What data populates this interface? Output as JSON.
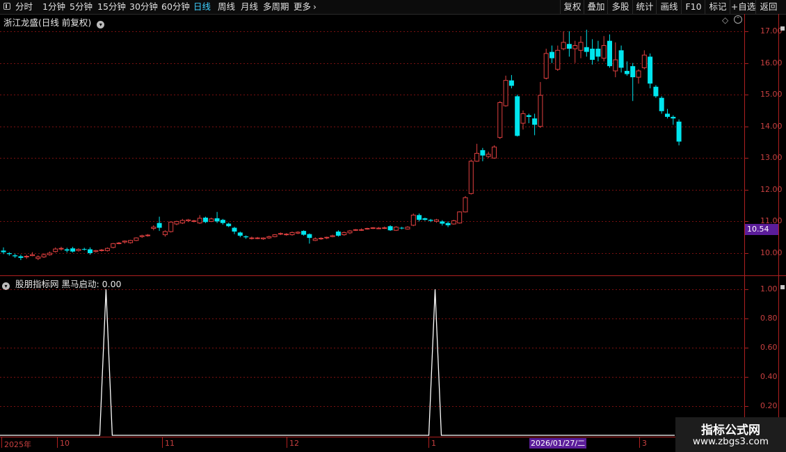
{
  "toolbar": {
    "periods": [
      "分时",
      "1分钟",
      "5分钟",
      "15分钟",
      "30分钟",
      "60分钟",
      "日线",
      "周线",
      "月线",
      "多周期",
      "更多"
    ],
    "active_period": "日线",
    "buttons": [
      "复权",
      "叠加",
      "多股",
      "统计",
      "画线",
      "F10",
      "标记",
      "+自选",
      "返回"
    ]
  },
  "main_panel": {
    "title": "浙江龙盛(日线 前复权)",
    "y_ticks": [
      "17.00",
      "16.00",
      "15.00",
      "14.00",
      "13.00",
      "12.00",
      "11.00",
      "10.00"
    ],
    "current_price": "10.54"
  },
  "indicator_panel": {
    "title": "股朋指标网 黑马启动: 0.00",
    "y_ticks": [
      "1.00",
      "0.80",
      "0.60",
      "0.40",
      "0.20"
    ]
  },
  "x_axis": {
    "labels": [
      "2025年",
      "10",
      "11",
      "12",
      "1",
      "3"
    ],
    "cursor_date": "2026/01/27/二"
  },
  "watermark": {
    "line1": "指标公式网",
    "line2": "www.zbgs3.com"
  },
  "colors": {
    "up": "#e04040",
    "down": "#00e5ee",
    "cursor": "#5b1d9a",
    "signal": "#ffffff"
  },
  "chart_data": [
    {
      "type": "candlestick",
      "ylim": [
        9.7,
        17.2
      ],
      "candles": [
        [
          10.08,
          10.03,
          10.18,
          9.97
        ],
        [
          10.0,
          9.97,
          10.03,
          9.92
        ],
        [
          9.93,
          9.9,
          9.98,
          9.85
        ],
        [
          9.9,
          9.85,
          9.95,
          9.78
        ],
        [
          9.88,
          9.9,
          9.95,
          9.82
        ],
        [
          9.92,
          9.95,
          10.03,
          9.9
        ],
        [
          9.83,
          9.88,
          9.93,
          9.78
        ],
        [
          9.88,
          9.95,
          10.0,
          9.85
        ],
        [
          9.95,
          10.0,
          10.05,
          9.92
        ],
        [
          10.05,
          10.13,
          10.18,
          10.02
        ],
        [
          10.13,
          10.15,
          10.2,
          10.08
        ],
        [
          10.12,
          10.08,
          10.17,
          10.02
        ],
        [
          10.15,
          10.05,
          10.2,
          10.02
        ],
        [
          10.08,
          10.12,
          10.15,
          10.05
        ],
        [
          10.13,
          10.12,
          10.17,
          10.08
        ],
        [
          10.12,
          10.0,
          10.18,
          9.95
        ],
        [
          10.05,
          10.08,
          10.1,
          10.02
        ],
        [
          10.08,
          10.1,
          10.13,
          10.05
        ],
        [
          10.08,
          10.15,
          10.18,
          10.05
        ],
        [
          10.18,
          10.3,
          10.32,
          10.15
        ],
        [
          10.3,
          10.32,
          10.35,
          10.28
        ],
        [
          10.35,
          10.38,
          10.4,
          10.3
        ],
        [
          10.33,
          10.4,
          10.42,
          10.3
        ],
        [
          10.4,
          10.48,
          10.5,
          10.38
        ],
        [
          10.52,
          10.55,
          10.58,
          10.48
        ],
        [
          10.55,
          10.57,
          10.6,
          10.52
        ],
        [
          10.78,
          10.82,
          10.88,
          10.72
        ],
        [
          10.95,
          10.8,
          11.15,
          10.7
        ],
        [
          10.58,
          10.68,
          10.72,
          10.52
        ],
        [
          10.68,
          10.98,
          11.0,
          10.65
        ],
        [
          10.92,
          11.0,
          11.02,
          10.88
        ],
        [
          10.95,
          11.03,
          11.08,
          10.92
        ],
        [
          11.02,
          11.05,
          11.08,
          10.98
        ],
        [
          11.0,
          11.02,
          11.05,
          10.97
        ],
        [
          10.95,
          11.1,
          11.2,
          10.92
        ],
        [
          11.12,
          10.98,
          11.15,
          10.95
        ],
        [
          11.0,
          11.08,
          11.12,
          10.98
        ],
        [
          11.1,
          11.0,
          11.3,
          10.95
        ],
        [
          11.05,
          10.95,
          11.08,
          10.9
        ],
        [
          10.93,
          10.85,
          10.96,
          10.82
        ],
        [
          10.8,
          10.68,
          10.83,
          10.6
        ],
        [
          10.65,
          10.55,
          10.68,
          10.5
        ],
        [
          10.53,
          10.5,
          10.56,
          10.45
        ],
        [
          10.47,
          10.48,
          10.52,
          10.43
        ],
        [
          10.47,
          10.48,
          10.51,
          10.44
        ],
        [
          10.45,
          10.48,
          10.5,
          10.42
        ],
        [
          10.48,
          10.52,
          10.55,
          10.45
        ],
        [
          10.52,
          10.58,
          10.6,
          10.5
        ],
        [
          10.6,
          10.62,
          10.65,
          10.57
        ],
        [
          10.58,
          10.6,
          10.63,
          10.55
        ],
        [
          10.58,
          10.65,
          10.68,
          10.55
        ],
        [
          10.63,
          10.66,
          10.69,
          10.6
        ],
        [
          10.7,
          10.58,
          10.72,
          10.55
        ],
        [
          10.6,
          10.48,
          10.62,
          10.3
        ],
        [
          10.4,
          10.45,
          10.5,
          10.38
        ],
        [
          10.45,
          10.47,
          10.5,
          10.42
        ],
        [
          10.48,
          10.5,
          10.52,
          10.44
        ],
        [
          10.52,
          10.55,
          10.58,
          10.5
        ],
        [
          10.68,
          10.55,
          10.72,
          10.52
        ],
        [
          10.58,
          10.65,
          10.68,
          10.55
        ],
        [
          10.64,
          10.7,
          10.73,
          10.6
        ],
        [
          10.72,
          10.74,
          10.76,
          10.7
        ],
        [
          10.72,
          10.74,
          10.78,
          10.7
        ],
        [
          10.76,
          10.78,
          10.8,
          10.74
        ],
        [
          10.79,
          10.8,
          10.82,
          10.76
        ],
        [
          10.78,
          10.79,
          10.82,
          10.76
        ],
        [
          10.78,
          10.8,
          10.84,
          10.76
        ],
        [
          10.85,
          10.72,
          10.88,
          10.7
        ],
        [
          10.72,
          10.82,
          10.85,
          10.7
        ],
        [
          10.8,
          10.78,
          10.83,
          10.75
        ],
        [
          10.76,
          10.82,
          10.85,
          10.74
        ],
        [
          10.88,
          11.2,
          11.25,
          10.85
        ],
        [
          11.2,
          11.05,
          11.25,
          11.0
        ],
        [
          11.1,
          11.05,
          11.12,
          11.02
        ],
        [
          11.05,
          11.02,
          11.08,
          10.98
        ],
        [
          11.0,
          11.05,
          11.08,
          10.96
        ],
        [
          11.0,
          10.93,
          11.04,
          10.87
        ],
        [
          10.95,
          10.88,
          11.0,
          10.82
        ],
        [
          10.92,
          11.02,
          11.05,
          10.9
        ],
        [
          10.95,
          11.3,
          11.32,
          10.93
        ],
        [
          11.3,
          11.75,
          11.8,
          11.28
        ],
        [
          11.88,
          12.9,
          12.95,
          11.85
        ],
        [
          12.9,
          13.15,
          13.45,
          12.88
        ],
        [
          13.25,
          13.08,
          13.32,
          12.9
        ],
        [
          13.05,
          13.12,
          13.2,
          13.0
        ],
        [
          13.0,
          13.35,
          13.4,
          12.98
        ],
        [
          13.65,
          14.75,
          14.8,
          13.6
        ],
        [
          14.65,
          15.45,
          15.6,
          14.62
        ],
        [
          15.45,
          15.28,
          15.62,
          15.2
        ],
        [
          14.95,
          13.7,
          15.0,
          13.68
        ],
        [
          14.1,
          14.4,
          14.5,
          13.9
        ],
        [
          14.35,
          14.3,
          14.4,
          14.1
        ],
        [
          14.25,
          14.05,
          14.4,
          13.72
        ],
        [
          14.0,
          14.98,
          15.4,
          13.95
        ],
        [
          15.52,
          16.3,
          16.45,
          15.48
        ],
        [
          16.35,
          16.15,
          16.55,
          16.0
        ],
        [
          15.8,
          16.4,
          16.55,
          15.75
        ],
        [
          16.45,
          16.65,
          17.0,
          16.4
        ],
        [
          16.6,
          16.45,
          17.0,
          16.2
        ],
        [
          16.45,
          16.55,
          16.7,
          16.0
        ],
        [
          16.4,
          16.65,
          16.85,
          16.15
        ],
        [
          16.5,
          16.35,
          17.05,
          16.2
        ],
        [
          16.45,
          16.1,
          16.75,
          15.95
        ],
        [
          16.45,
          16.2,
          16.7,
          16.05
        ],
        [
          16.15,
          16.55,
          16.85,
          16.05
        ],
        [
          16.7,
          15.9,
          16.9,
          15.85
        ],
        [
          15.75,
          16.1,
          16.65,
          15.55
        ],
        [
          16.4,
          15.85,
          16.55,
          15.7
        ],
        [
          15.75,
          15.65,
          16.05,
          15.6
        ],
        [
          15.9,
          15.55,
          16.0,
          14.8
        ],
        [
          15.55,
          15.75,
          15.8,
          15.35
        ],
        [
          15.85,
          16.25,
          16.4,
          15.8
        ],
        [
          16.2,
          15.35,
          16.3,
          15.2
        ],
        [
          15.25,
          14.95,
          15.3,
          14.9
        ],
        [
          14.9,
          14.48,
          14.95,
          14.4
        ],
        [
          14.4,
          14.3,
          14.55,
          14.25
        ],
        [
          14.3,
          14.25,
          14.35,
          14.05
        ],
        [
          14.15,
          13.52,
          14.22,
          13.4
        ]
      ]
    },
    {
      "type": "line",
      "series": [
        {
          "x": [
            8,
            65
          ],
          "values": [
            1.0,
            1.0
          ]
        }
      ],
      "baseline": 0,
      "ylim": [
        0,
        1.04
      ]
    }
  ]
}
